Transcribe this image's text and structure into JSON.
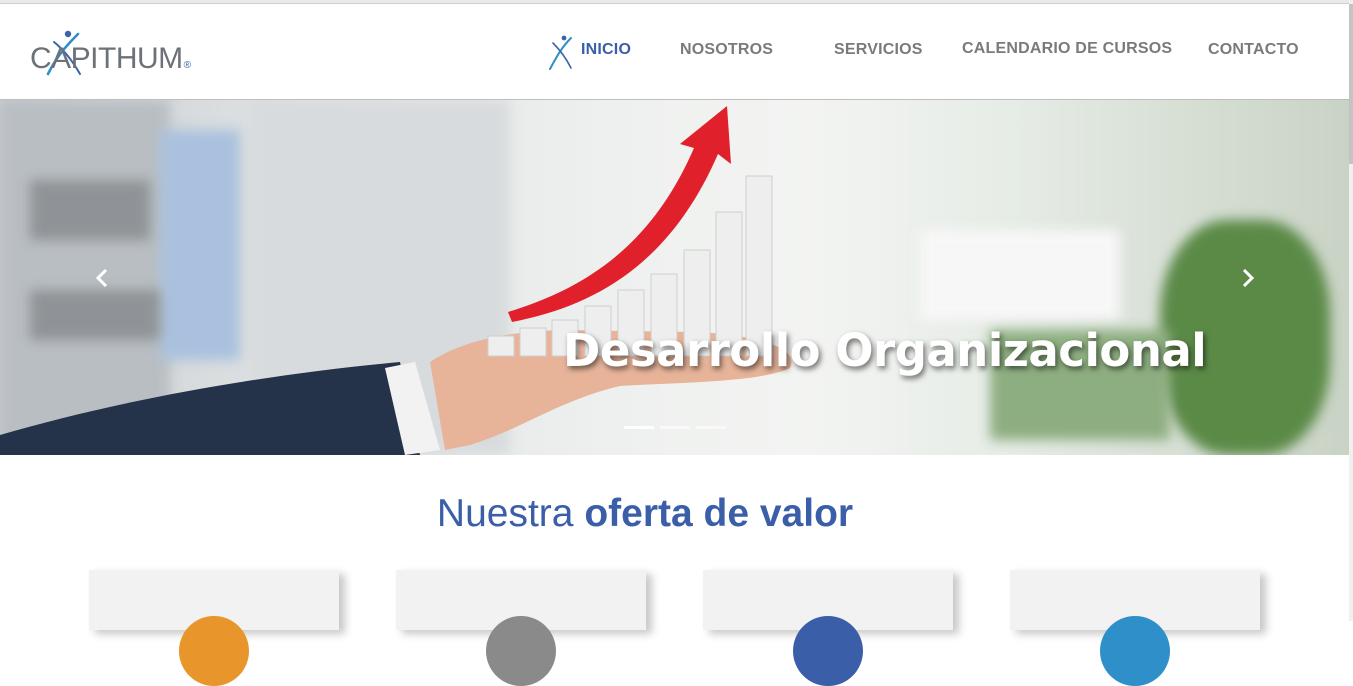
{
  "brand": {
    "name": "CAPITHUM",
    "registered_mark": "®",
    "color": "#3a5ea8"
  },
  "nav": {
    "items": [
      {
        "label": "INICIO",
        "active": true
      },
      {
        "label": "NOSOTROS",
        "active": false
      },
      {
        "label": "SERVICIOS",
        "active": false
      },
      {
        "label": "CALENDARIO DE CURSOS",
        "active": false
      },
      {
        "label": "CONTACTO",
        "active": false
      }
    ],
    "active_icon": "figure-icon"
  },
  "hero": {
    "slide_title": "Desarrollo Organizacional",
    "prev_icon": "chevron-left-icon",
    "next_icon": "chevron-right-icon",
    "slide_count": 3,
    "active_slide": 1
  },
  "offer": {
    "title_light": "Nuestra",
    "title_bold": "oferta de valor",
    "cards": [
      {
        "accent": "#e8952b"
      },
      {
        "accent": "#8a8a8a"
      },
      {
        "accent": "#3a5ea8"
      },
      {
        "accent": "#2f8fc9"
      }
    ]
  }
}
